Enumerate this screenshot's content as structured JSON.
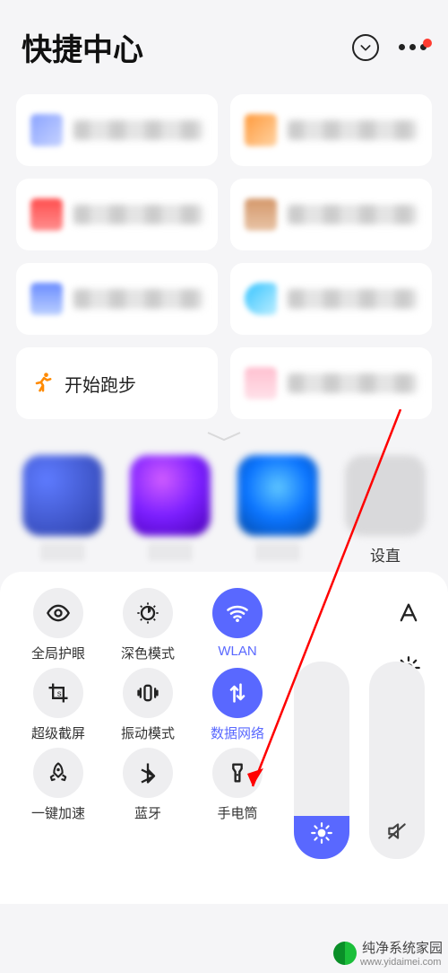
{
  "header": {
    "title": "快捷中心"
  },
  "cards": {
    "run_label": "开始跑步"
  },
  "apps": {
    "a4_label": "设直"
  },
  "toggles": {
    "eye": "全局护眼",
    "dark": "深色模式",
    "wlan": "WLAN",
    "screenshot": "超级截屏",
    "vibrate": "振动模式",
    "data": "数据网络",
    "boost": "一键加速",
    "bluetooth": "蓝牙",
    "torch": "手电筒"
  },
  "sliders": {
    "brightness_pct": 22
  },
  "watermark": {
    "name": "纯净系统家园",
    "url": "www.yidaimei.com"
  },
  "colors": {
    "accent": "#5968ff",
    "alert": "#ff3b30"
  }
}
